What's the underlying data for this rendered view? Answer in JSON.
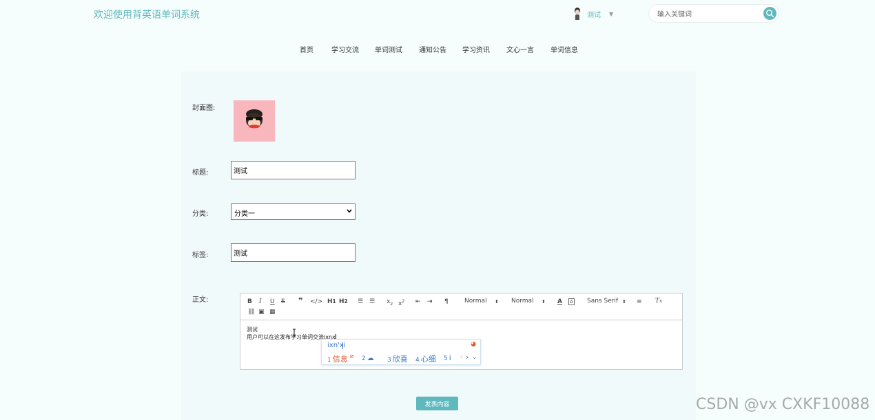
{
  "header": {
    "site_title": "欢迎使用背英语单词系统",
    "user_name": "测试",
    "search_placeholder": "输入关键词"
  },
  "nav": {
    "items": [
      {
        "label": "首页"
      },
      {
        "label": "学习交流"
      },
      {
        "label": "单词测试"
      },
      {
        "label": "通知公告"
      },
      {
        "label": "学习资讯"
      },
      {
        "label": "文心一言"
      },
      {
        "label": "单词信息"
      }
    ]
  },
  "form": {
    "cover_label": "封面图:",
    "title_label": "标题:",
    "title_value": "测试",
    "category_label": "分类:",
    "category_value": "分类一",
    "tags_label": "标签:",
    "tags_value": "测试",
    "body_label": "正文:",
    "submit_label": "发表内容"
  },
  "editor": {
    "header_select": "Normal",
    "size_select": "Normal",
    "font_select": "Sans Serif",
    "content_line1": "测试",
    "content_line2": "用户可以在这发布学习单词交流ixnx"
  },
  "ime": {
    "composition": "ixn'xi",
    "candidates": [
      {
        "num": "1",
        "text": "信息"
      },
      {
        "num": "2",
        "text": ""
      },
      {
        "num": "3",
        "text": "欣喜"
      },
      {
        "num": "4",
        "text": "心细"
      },
      {
        "num": "5",
        "text": "i"
      }
    ]
  },
  "watermark": "CSDN @vx  CXKF10088",
  "colors": {
    "accent": "#5fb8bd",
    "background": "#f6fdfd",
    "panel": "#f1fafa",
    "ime_blue": "#3a78c8",
    "ime_orange": "#e0552b"
  }
}
